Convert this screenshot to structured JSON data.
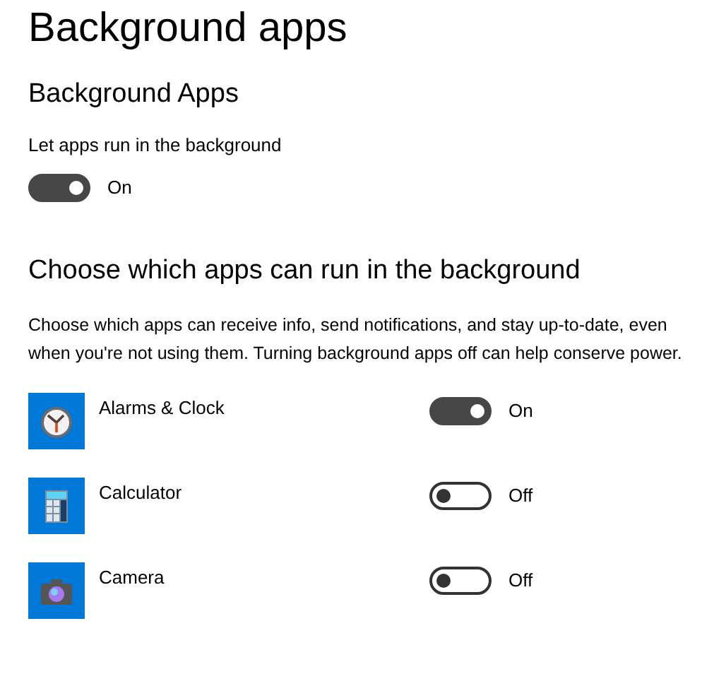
{
  "page_title": "Background apps",
  "section": {
    "title": "Background Apps",
    "label": "Let apps run in the background",
    "toggle": {
      "on": true,
      "state_text": "On"
    }
  },
  "apps_section": {
    "title": "Choose which apps can run in the background",
    "description": "Choose which apps can receive info, send notifications, and stay up-to-date, even when you're not using them. Turning background apps off can help conserve power.",
    "apps": [
      {
        "name": "Alarms & Clock",
        "kind": "clock",
        "on": true,
        "state_text": "On"
      },
      {
        "name": "Calculator",
        "kind": "calculator",
        "on": false,
        "state_text": "Off"
      },
      {
        "name": "Camera",
        "kind": "camera",
        "on": false,
        "state_text": "Off"
      }
    ]
  }
}
